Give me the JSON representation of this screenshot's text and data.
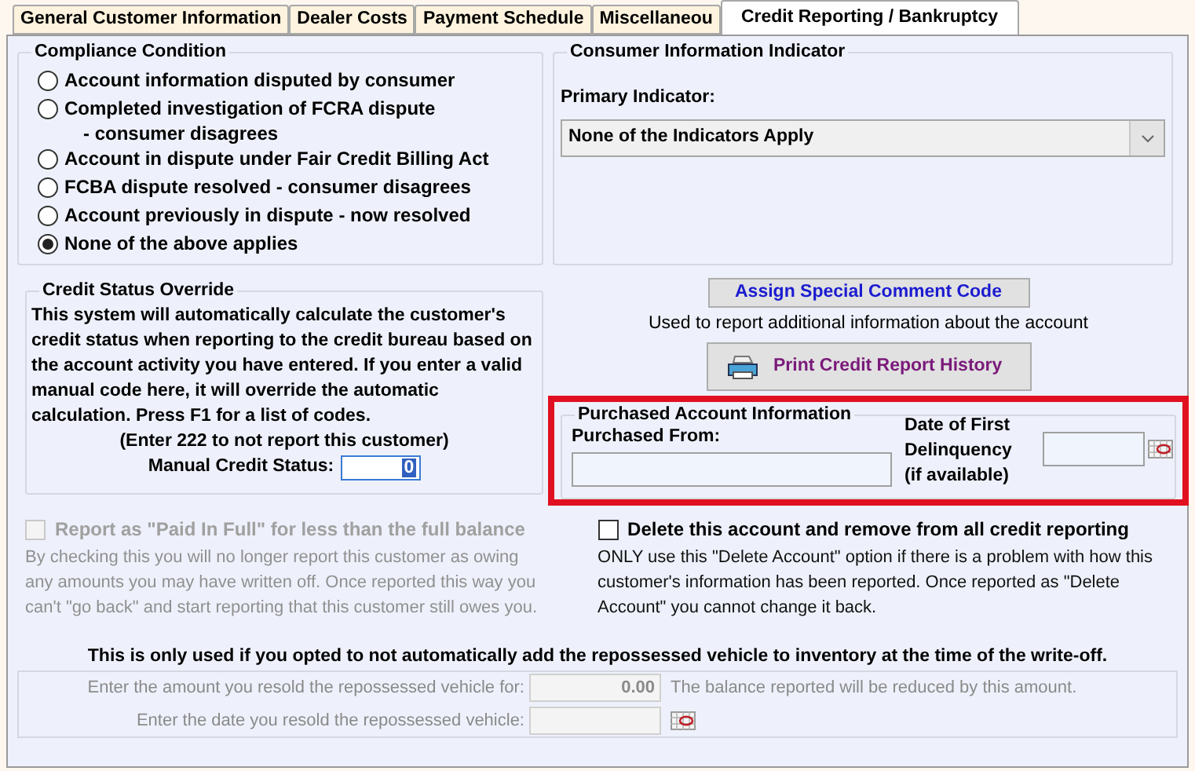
{
  "tabs": [
    {
      "label": "General Customer Information",
      "selected": false
    },
    {
      "label": "Dealer Costs",
      "selected": false
    },
    {
      "label": "Payment Schedule",
      "selected": false
    },
    {
      "label": "Miscellaneou",
      "selected": false
    },
    {
      "label": "Credit Reporting / Bankruptcy",
      "selected": true
    }
  ],
  "compliance": {
    "title": "Compliance Condition",
    "options": [
      {
        "label": "Account information disputed by consumer",
        "selected": false
      },
      {
        "label": "Completed investigation of FCRA dispute",
        "label_line_2": "- consumer disagrees",
        "selected": false
      },
      {
        "label": "Account in dispute under Fair Credit Billing Act",
        "selected": false
      },
      {
        "label": "FCBA dispute resolved - consumer disagrees",
        "selected": false
      },
      {
        "label": "Account previously in dispute - now resolved",
        "selected": false
      },
      {
        "label": "None of the above applies",
        "selected": true
      }
    ]
  },
  "consumer_info": {
    "title": "Consumer Information Indicator",
    "label": "Primary Indicator:",
    "value": "None of the Indicators Apply"
  },
  "credit_status": {
    "title": "Credit Status Override",
    "description": "This system will automatically calculate the customer's credit status when reporting to the credit bureau based on the account activity you have entered.  If you enter a valid manual code here, it will override the automatic calculation. Press F1 for a list of codes.",
    "note": "(Enter 222 to not report this customer)",
    "label": "Manual Credit Status:",
    "value": "0"
  },
  "assign_button": "Assign Special Comment Code",
  "assign_hint": "Used to report additional information about the account",
  "print_button": "Print Credit Report History",
  "purchased": {
    "title": "Purchased Account Information",
    "from_label": "Purchased From:",
    "date_label": "Date of First Delinquency (if available)"
  },
  "checkboxes": [
    {
      "label": "Report as \"Paid In Full\" for less than the full balance",
      "checked": false,
      "disabled": true,
      "description": "By checking this you will no longer report this customer as owing any amounts you may have written off.  Once reported this way you can't \"go back\" and start reporting that this customer still owes you."
    },
    {
      "label": "Delete this account and remove from all credit reporting",
      "checked": false,
      "disabled": false,
      "description": "ONLY use this \"Delete Account\" option if there is a problem with how this customer's information has been reported.  Once reported as \"Delete Account\" you cannot change it back."
    }
  ],
  "repo": {
    "notice": "This is only used if you opted to not automatically add the repossessed vehicle to inventory at the time of the write-off.",
    "disabled": true,
    "amount_label": "Enter the amount you resold the repossessed vehicle for:",
    "amount_value": "0.00",
    "amount_hint": "The balance reported will be reduced by this amount.",
    "date_label": "Enter the date you resold the repossessed vehicle:"
  }
}
